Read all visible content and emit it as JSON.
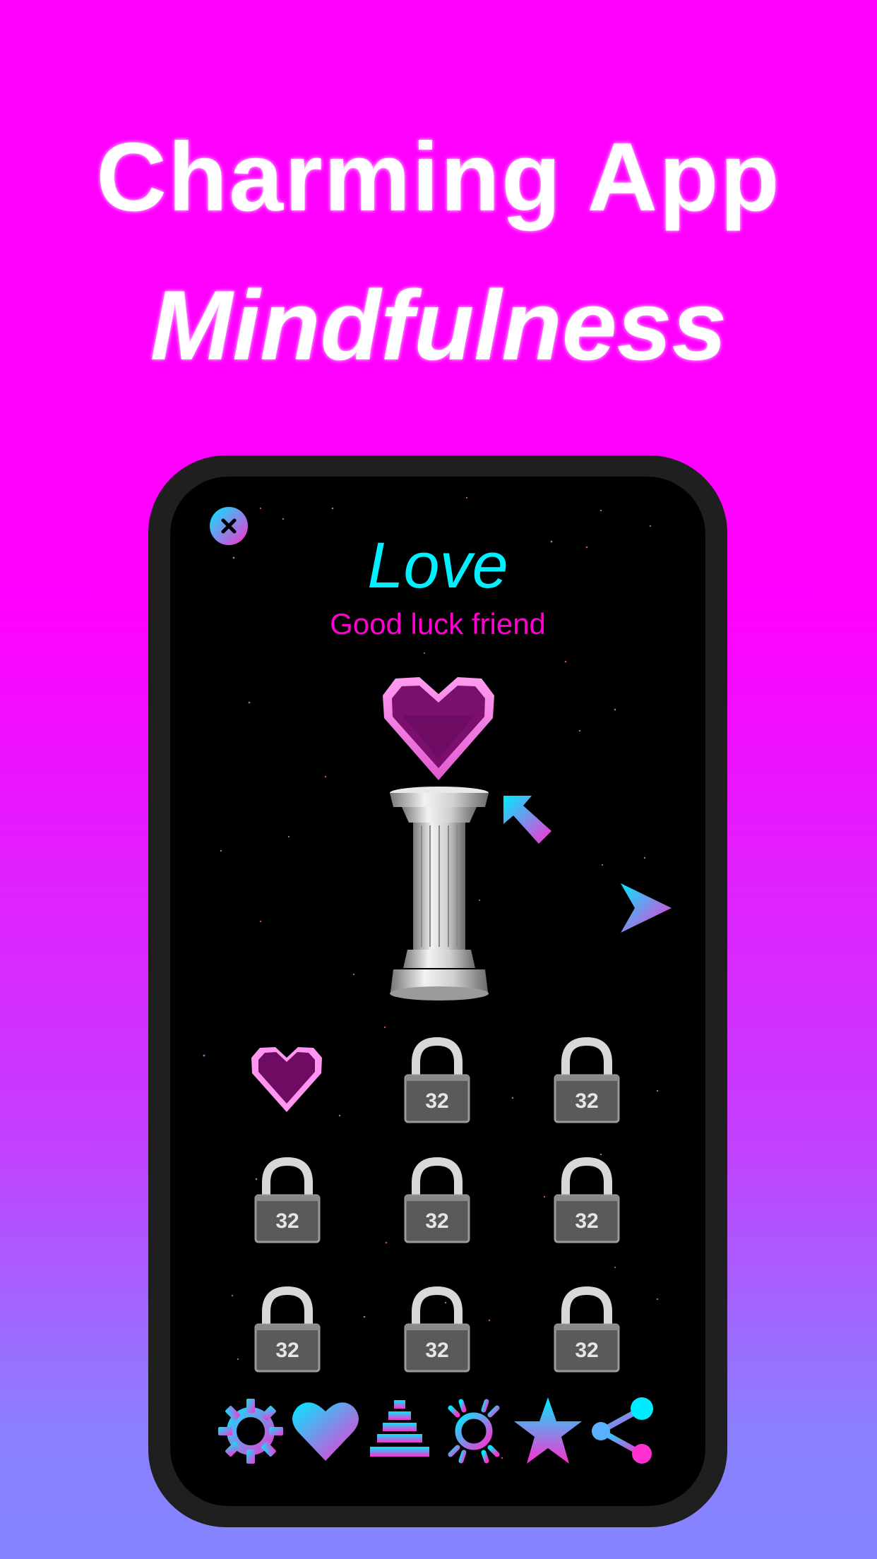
{
  "promo": {
    "line1": "Charming App",
    "line2": "Mindfulness"
  },
  "header": {
    "title": "Love",
    "subtitle": "Good luck friend"
  },
  "colors": {
    "background_top": "#ff00ff",
    "background_bottom": "#8585ff",
    "title": "#00f0ff",
    "subtitle": "#ff00d0",
    "icon_gradient_start": "#00eaff",
    "icon_gradient_end": "#ff2fd0"
  },
  "grid": {
    "first_item": "heart",
    "locks": [
      {
        "label": "32"
      },
      {
        "label": "32"
      },
      {
        "label": "32"
      },
      {
        "label": "32"
      },
      {
        "label": "32"
      },
      {
        "label": "32"
      },
      {
        "label": "32"
      },
      {
        "label": "32"
      }
    ]
  },
  "toolbar": {
    "icons": [
      "settings-gear-icon",
      "heart-icon",
      "levels-pyramid-icon",
      "sun-icon",
      "star-icon",
      "share-icon"
    ]
  }
}
